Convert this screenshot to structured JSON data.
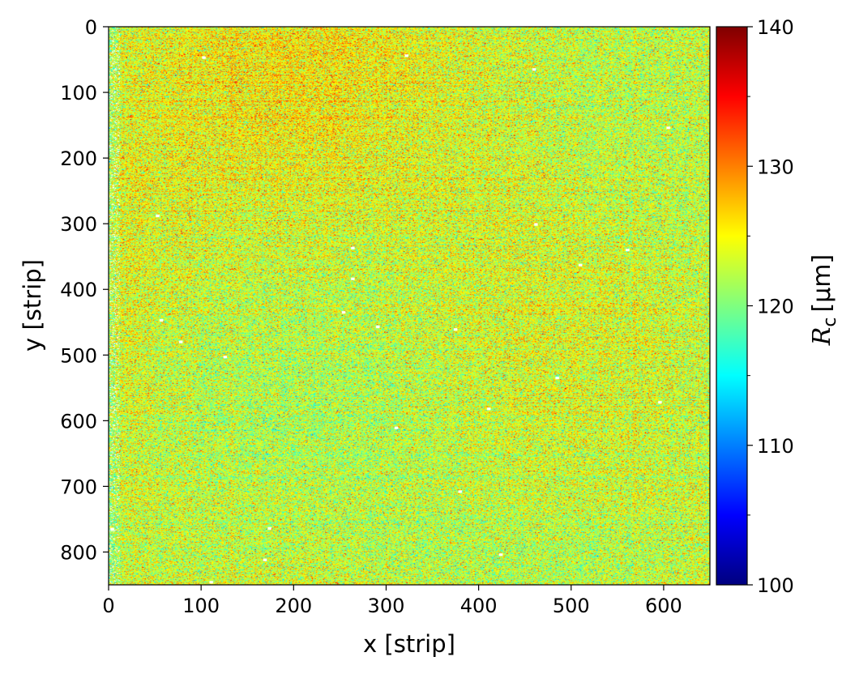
{
  "chart_data": {
    "type": "heatmap",
    "title": "",
    "xlabel": "x [strip]",
    "ylabel": "y [strip]",
    "xlim": [
      0,
      650
    ],
    "ylim": [
      850,
      0
    ],
    "x_ticks": [
      0,
      100,
      200,
      300,
      400,
      500,
      600
    ],
    "y_ticks": [
      0,
      100,
      200,
      300,
      400,
      500,
      600,
      700,
      800
    ],
    "colorbar": {
      "label_symbol": "R",
      "label_subscript": "c",
      "label_unit": "[µm]",
      "min": 100,
      "max": 140,
      "ticks": [
        100,
        110,
        120,
        130,
        140
      ],
      "colormap": "jet"
    },
    "colormap_stops": [
      "#00007f",
      "#0000ff",
      "#007fff",
      "#00ffff",
      "#7fff7f",
      "#ffff00",
      "#ff7f00",
      "#ff0000",
      "#7f0000"
    ],
    "value_distribution": {
      "mean": 123.5,
      "typical_range": [
        116,
        131
      ]
    },
    "missing_value_color": "#ffffff",
    "grid": false
  }
}
